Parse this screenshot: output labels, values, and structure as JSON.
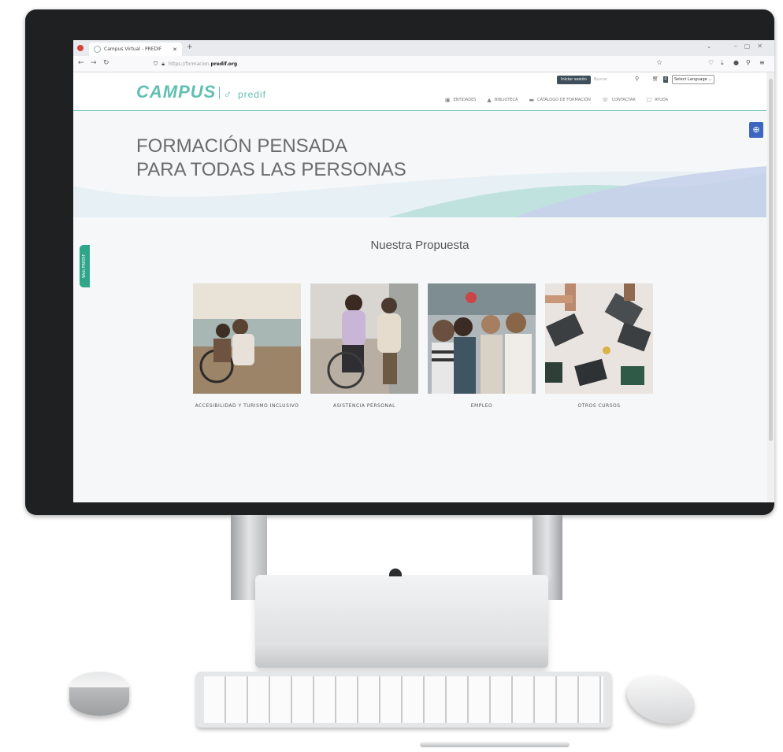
{
  "browser": {
    "tab_title": "Campus Virtual - PREDIF",
    "url_prefix": "https://formacion.",
    "url_domain": "predif.org"
  },
  "header": {
    "logo_campus": "CAMPUS",
    "logo_predif": "predif",
    "login_button": "Iniciar sesión",
    "search_placeholder": "Buscar",
    "cart_count": "0",
    "language_select": "Select Language"
  },
  "menu": [
    {
      "label": "ENTIDADES",
      "icon": "building-icon"
    },
    {
      "label": "BIBLIOTECA",
      "icon": "library-icon"
    },
    {
      "label": "CATÁLOGO DE FORMACIÓN",
      "icon": "catalog-icon"
    },
    {
      "label": "CONTACTAR",
      "icon": "contact-icon"
    },
    {
      "label": "AYUDA",
      "icon": "help-icon"
    }
  ],
  "hero": {
    "line1": "FORMACIÓN PENSADA",
    "line2": "PARA TODAS LAS PERSONAS"
  },
  "side_tab": "Web PREDIF",
  "section": {
    "title": "Nuestra Propuesta"
  },
  "cards": [
    {
      "label": "ACCESIBILIDAD Y TURISMO INCLUSIVO"
    },
    {
      "label": "ASISTENCIA PERSONAL"
    },
    {
      "label": "EMPLEO"
    },
    {
      "label": "OTROS CURSOS"
    }
  ],
  "colors": {
    "brand": "#5fbfb1",
    "access_button": "#3d66c1",
    "login_button": "#3e4e5a",
    "side_tab": "#2fa689"
  }
}
